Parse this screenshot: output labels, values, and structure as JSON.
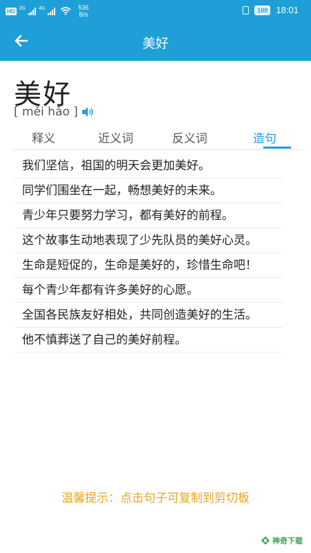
{
  "status_bar": {
    "hd": "HD",
    "net_left": "2G",
    "net_right": "4G",
    "speed_value": "536",
    "speed_unit": "B/s",
    "battery": "100",
    "time": "18:01"
  },
  "app_bar": {
    "title": "美好"
  },
  "word": {
    "text": "美好",
    "pinyin": "[ měi hǎo ]"
  },
  "tabs": [
    {
      "label": "释义",
      "active": false
    },
    {
      "label": "近义词",
      "active": false
    },
    {
      "label": "反义词",
      "active": false
    },
    {
      "label": "造句",
      "active": true
    }
  ],
  "sentences": [
    "我们坚信，祖国的明天会更加美好。",
    "同学们围坐在一起，畅想美好的未来。",
    "青少年只要努力学习，都有美好的前程。",
    "这个故事生动地表现了少先队员的美好心灵。",
    "生命是短促的，生命是美好的，珍惜生命吧！",
    "每个青少年都有许多美好的心愿。",
    "全国各民族友好相处，共同创造美好的生活。",
    "他不慎葬送了自己的美好前程。"
  ],
  "tip": "温馨提示：点击句子可复制到剪切板",
  "watermark": "神奇下载",
  "colors": {
    "primary": "#1e9fd8",
    "tip": "#e8a525"
  }
}
